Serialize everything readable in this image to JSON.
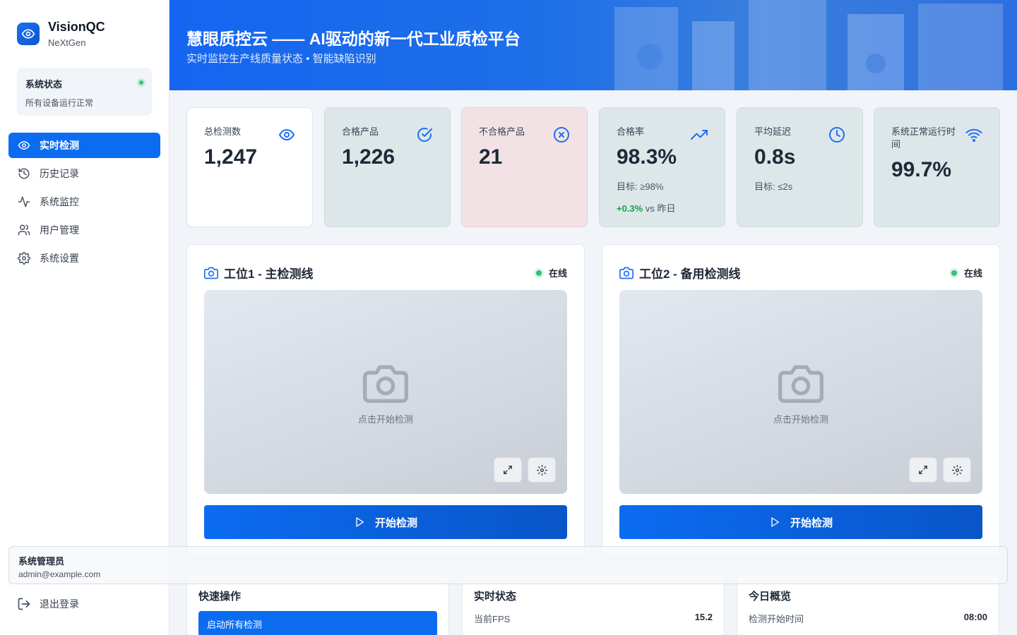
{
  "brand": {
    "name": "VisionQC",
    "sub": "NeXtGen"
  },
  "system_status": {
    "title": "系统状态",
    "desc": "所有设备运行正常"
  },
  "nav": [
    {
      "label": "实时检测",
      "icon": "eye-icon",
      "active": true
    },
    {
      "label": "历史记录",
      "icon": "history-icon"
    },
    {
      "label": "系统监控",
      "icon": "activity-icon"
    },
    {
      "label": "用户管理",
      "icon": "users-icon"
    },
    {
      "label": "系统设置",
      "icon": "gear-icon"
    }
  ],
  "user": {
    "name": "系统管理员",
    "email": "admin@example.com"
  },
  "logout_label": "退出登录",
  "banner": {
    "title": "慧眼质控云 —— AI驱动的新一代工业质检平台",
    "subtitle": "实时监控生产线质量状态 • 智能缺陷识别"
  },
  "stats": [
    {
      "label": "总检测数",
      "value": "1,247",
      "icon": "eye-icon"
    },
    {
      "label": "合格产品",
      "value": "1,226",
      "icon": "check-circle-icon"
    },
    {
      "label": "不合格产品",
      "value": "21",
      "icon": "x-circle-icon"
    },
    {
      "label": "合格率",
      "value": "98.3%",
      "target": "目标: ≥98%",
      "delta": "+0.3%",
      "delta_suffix": "vs 昨日",
      "icon": "trending-up-icon"
    },
    {
      "label": "平均延迟",
      "value": "0.8s",
      "target": "目标: ≤2s",
      "icon": "clock-icon"
    },
    {
      "label": "系统正常运行时间",
      "value": "99.7%",
      "icon": "wifi-icon"
    }
  ],
  "stations": [
    {
      "title": "工位1 - 主检测线",
      "status": "在线",
      "hint": "点击开始检测",
      "start_label": "开始检测"
    },
    {
      "title": "工位2 - 备用检测线",
      "status": "在线",
      "hint": "点击开始检测",
      "start_label": "开始检测"
    }
  ],
  "quick_ops": {
    "title": "快速操作",
    "button": "启动所有检测"
  },
  "realtime": {
    "title": "实时状态",
    "rows": [
      {
        "k": "当前FPS",
        "v": "15.2"
      }
    ]
  },
  "overview": {
    "title": "今日概览",
    "rows": [
      {
        "k": "检测开始时间",
        "v": "08:00"
      }
    ]
  },
  "colors": {
    "primary": "#0b6cf0",
    "success": "#16a34a",
    "danger_bg": "#f6e3e6",
    "success_bg": "#dde7ea"
  }
}
